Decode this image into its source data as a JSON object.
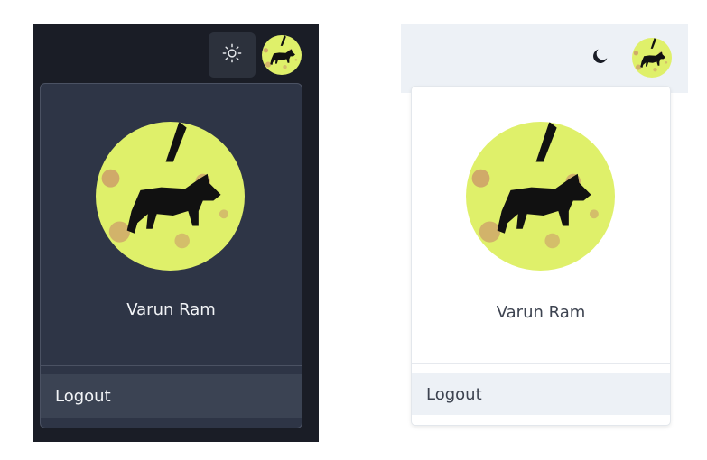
{
  "dark_theme": {
    "theme_toggle_icon": "sun-icon",
    "user": {
      "name": "Varun Ram",
      "avatar": "wolf-avatar"
    },
    "menu": {
      "logout_label": "Logout"
    },
    "colors": {
      "background": "#1a1d26",
      "menu_bg": "#2e3546",
      "hover_bg": "#3b4353",
      "text": "#f2f4f7"
    }
  },
  "light_theme": {
    "theme_toggle_icon": "moon-icon",
    "user": {
      "name": "Varun Ram",
      "avatar": "wolf-avatar"
    },
    "menu": {
      "logout_label": "Logout"
    },
    "colors": {
      "topbar_bg": "#edf1f6",
      "menu_bg": "#ffffff",
      "hover_bg": "#edf1f6",
      "text": "#3d4350"
    }
  }
}
